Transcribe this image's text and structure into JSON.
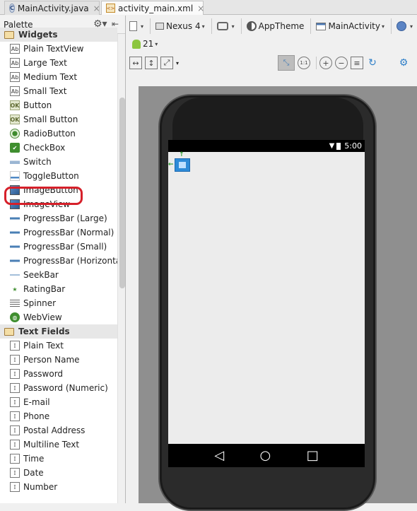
{
  "tabs": [
    {
      "label": "MainActivity.java",
      "icon": "java-class-icon",
      "active": false
    },
    {
      "label": "activity_main.xml",
      "icon": "xml-file-icon",
      "active": true
    }
  ],
  "palette": {
    "title": "Palette",
    "categories": [
      {
        "label": "Widgets",
        "items": [
          {
            "label": "Plain TextView",
            "icon": "textview-icon"
          },
          {
            "label": "Large Text",
            "icon": "textview-icon"
          },
          {
            "label": "Medium Text",
            "icon": "textview-icon"
          },
          {
            "label": "Small Text",
            "icon": "textview-icon"
          },
          {
            "label": "Button",
            "icon": "button-icon"
          },
          {
            "label": "Small Button",
            "icon": "button-icon"
          },
          {
            "label": "RadioButton",
            "icon": "radio-icon"
          },
          {
            "label": "CheckBox",
            "icon": "checkbox-icon"
          },
          {
            "label": "Switch",
            "icon": "switch-icon"
          },
          {
            "label": "ToggleButton",
            "icon": "toggle-icon"
          },
          {
            "label": "ImageButton",
            "icon": "image-button-icon"
          },
          {
            "label": "ImageView",
            "icon": "image-view-icon"
          },
          {
            "label": "ProgressBar (Large)",
            "icon": "progressbar-icon"
          },
          {
            "label": "ProgressBar (Normal)",
            "icon": "progressbar-icon"
          },
          {
            "label": "ProgressBar (Small)",
            "icon": "progressbar-icon"
          },
          {
            "label": "ProgressBar (Horizontal)",
            "icon": "progressbar-icon"
          },
          {
            "label": "SeekBar",
            "icon": "seekbar-icon"
          },
          {
            "label": "RatingBar",
            "icon": "star-icon"
          },
          {
            "label": "Spinner",
            "icon": "spinner-icon"
          },
          {
            "label": "WebView",
            "icon": "globe-icon"
          }
        ]
      },
      {
        "label": "Text Fields",
        "items": [
          {
            "label": "Plain Text",
            "icon": "text-field-icon"
          },
          {
            "label": "Person Name",
            "icon": "text-field-icon"
          },
          {
            "label": "Password",
            "icon": "text-field-icon"
          },
          {
            "label": "Password (Numeric)",
            "icon": "text-field-icon"
          },
          {
            "label": "E-mail",
            "icon": "text-field-icon"
          },
          {
            "label": "Phone",
            "icon": "text-field-icon"
          },
          {
            "label": "Postal Address",
            "icon": "text-field-icon"
          },
          {
            "label": "Multiline Text",
            "icon": "text-field-icon"
          },
          {
            "label": "Time",
            "icon": "text-field-icon"
          },
          {
            "label": "Date",
            "icon": "text-field-icon"
          },
          {
            "label": "Number",
            "icon": "text-field-icon"
          }
        ]
      }
    ]
  },
  "toolbar": {
    "device": "Nexus 4",
    "theme": "AppTheme",
    "activity": "MainActivity",
    "api_level": "21",
    "zoom_actual_label": "1:1"
  },
  "device_preview": {
    "clock": "5:00"
  },
  "colors": {
    "highlight": "#d6202a",
    "selection": "#2e8bd8"
  }
}
